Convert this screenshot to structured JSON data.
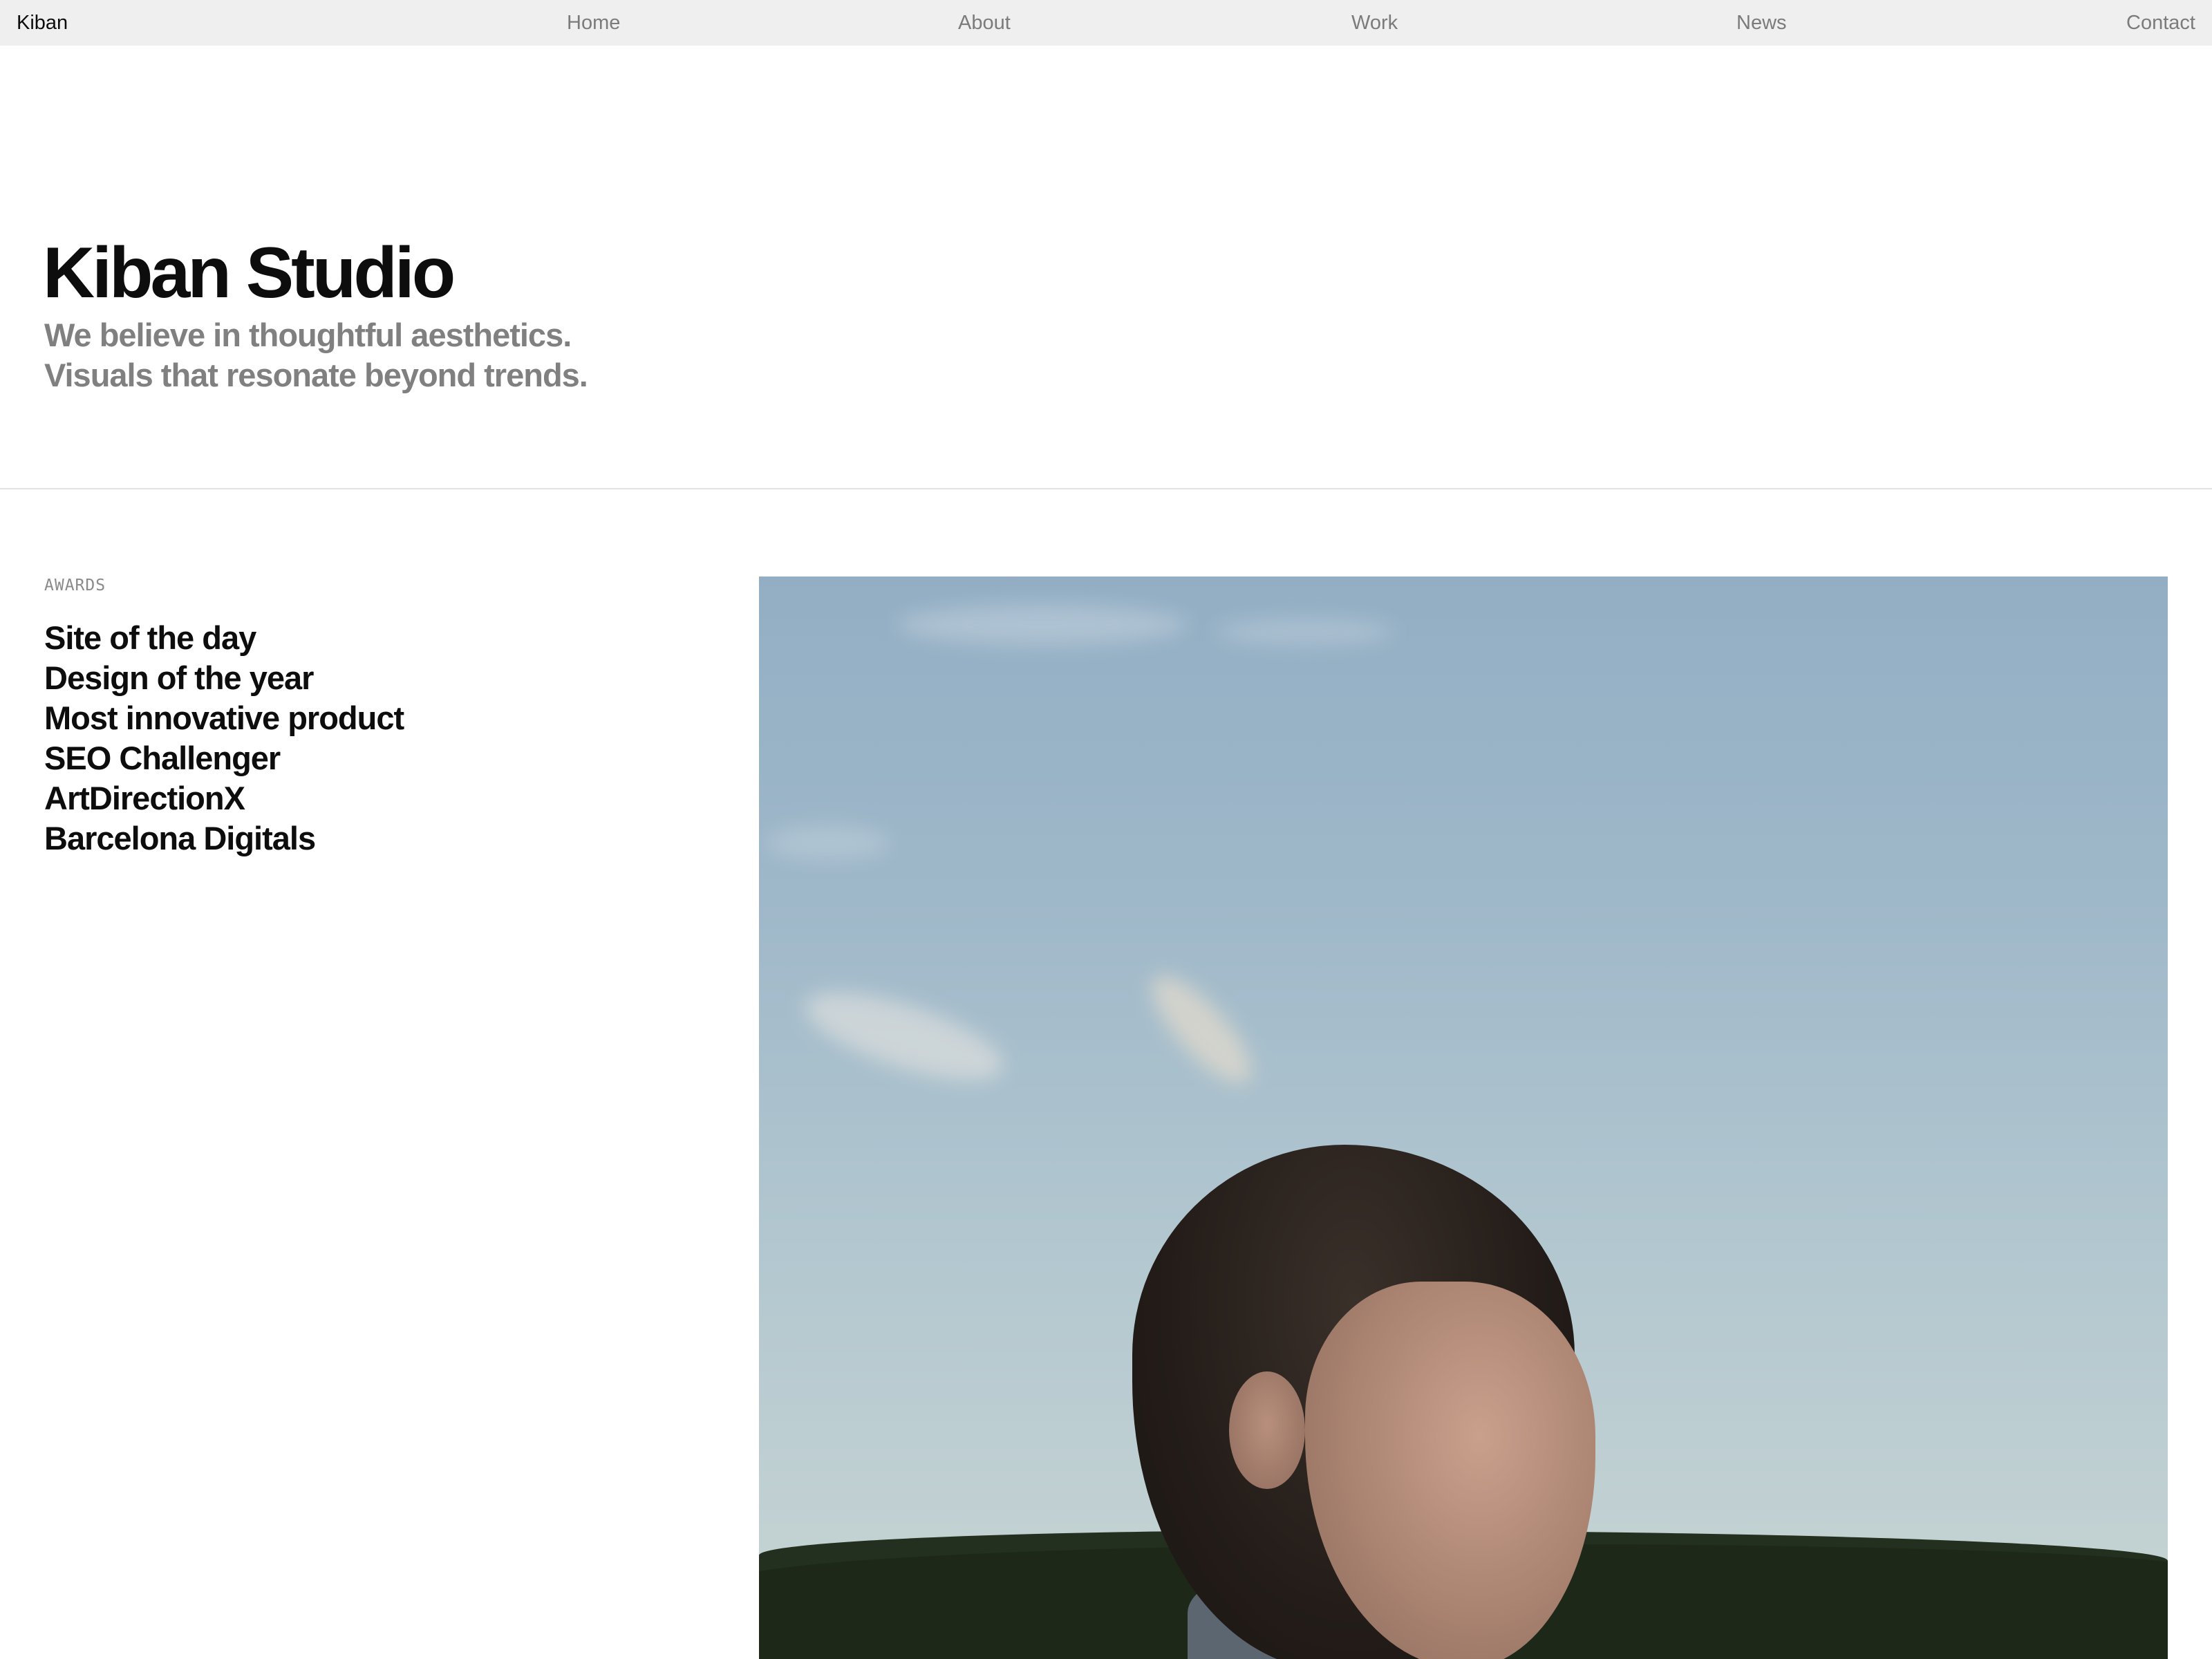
{
  "nav": {
    "brand": "Kiban",
    "items": [
      {
        "label": "Home"
      },
      {
        "label": "About"
      },
      {
        "label": "Work"
      },
      {
        "label": "News"
      },
      {
        "label": "Contact"
      }
    ]
  },
  "hero": {
    "title": "Kiban Studio",
    "subtitle_lines": [
      "We believe in thoughtful aesthetics.",
      "Visuals that resonate beyond trends."
    ]
  },
  "awards": {
    "label": "AWARDS",
    "items": [
      "Site of the day",
      "Design of the year",
      "Most innovative product",
      "SEO Challenger",
      "ArtDirectionX",
      "Barcelona Digitals"
    ]
  },
  "colors": {
    "nav_background": "#efefef",
    "nav_link": "#7b7b7b",
    "subtitle": "#808080",
    "text": "#0d0d0d"
  }
}
